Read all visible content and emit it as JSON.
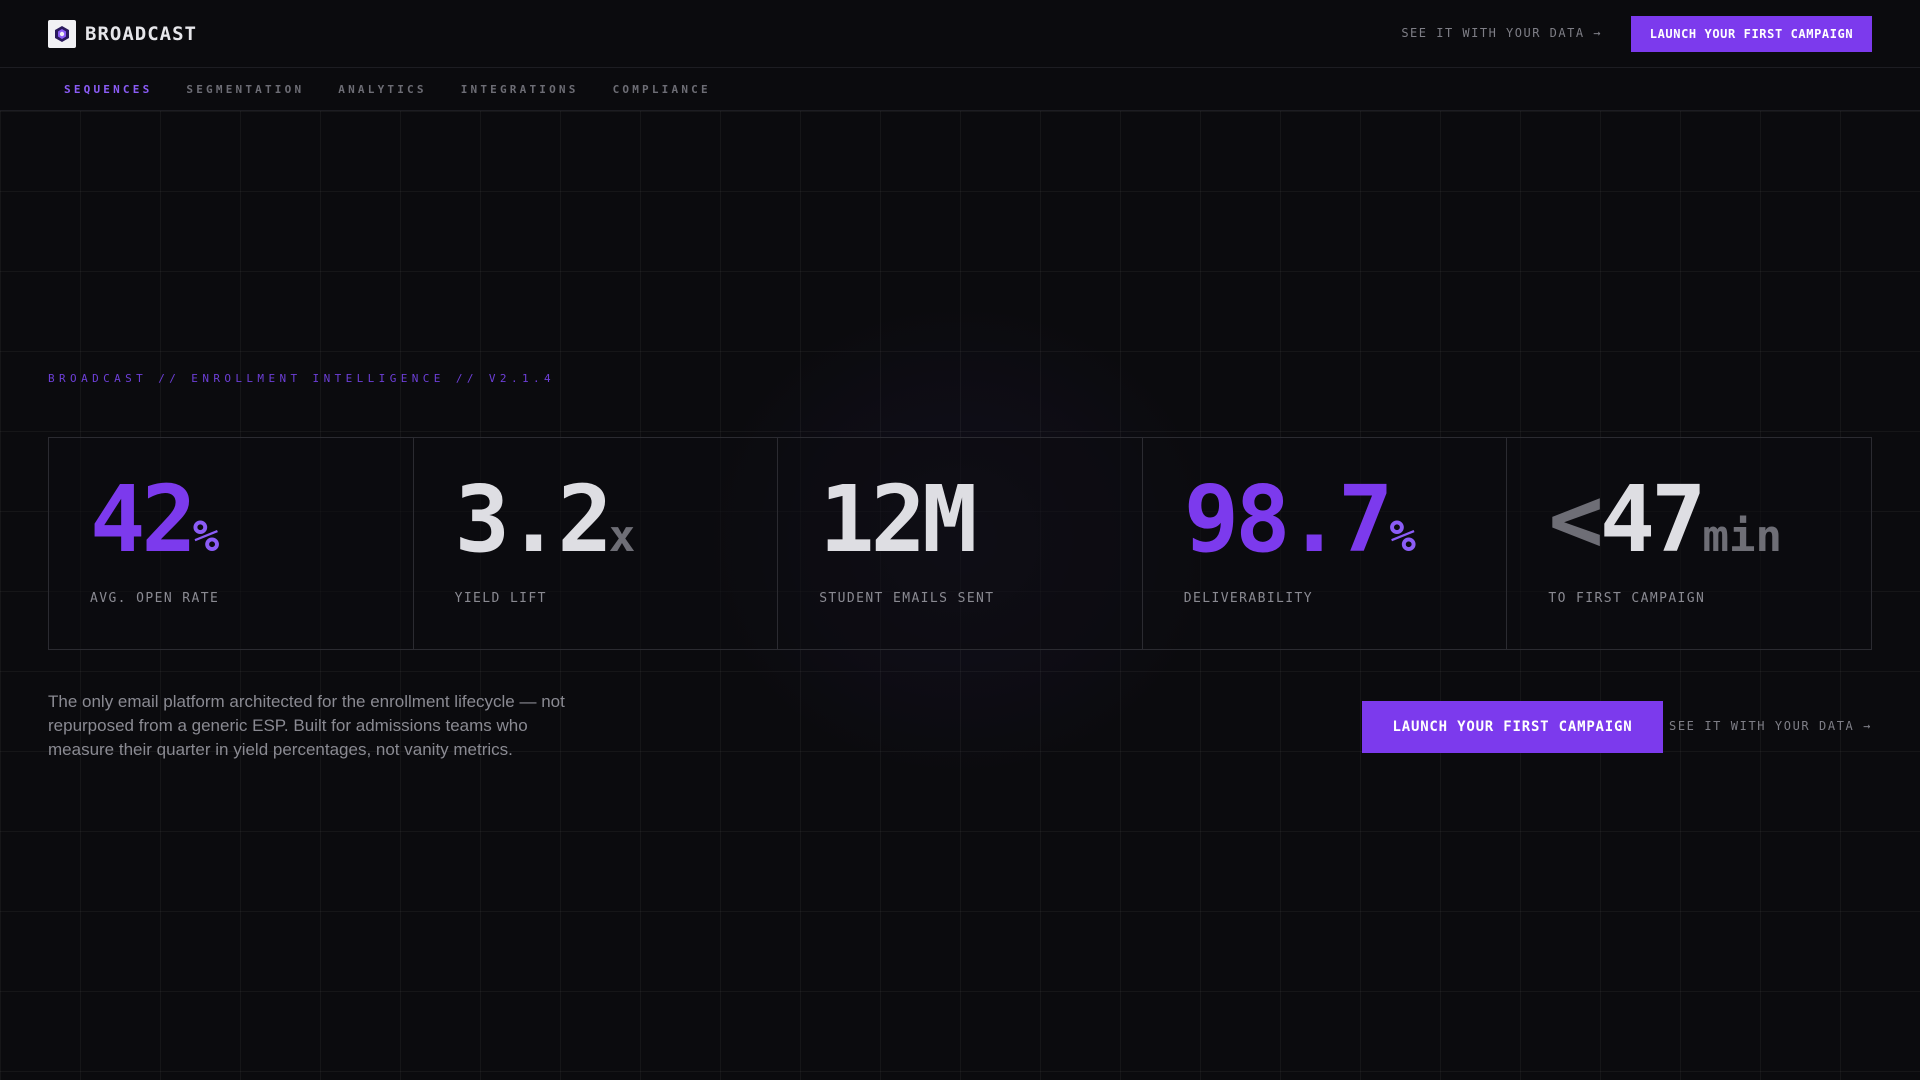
{
  "header": {
    "brand_name": "BROADCAST",
    "see_data_link": "SEE IT WITH YOUR DATA →",
    "cta_label": "LAUNCH YOUR FIRST CAMPAIGN"
  },
  "nav": {
    "items": [
      {
        "label": "SEQUENCES",
        "active": true
      },
      {
        "label": "SEGMENTATION"
      },
      {
        "label": "ANALYTICS"
      },
      {
        "label": "INTEGRATIONS"
      },
      {
        "label": "COMPLIANCE"
      }
    ]
  },
  "hero": {
    "eyebrow": "BROADCAST // ENROLLMENT INTELLIGENCE // V2.1.4",
    "stats": [
      {
        "prefix": "",
        "value": "42",
        "unit": "%",
        "label": "AVG. OPEN RATE"
      },
      {
        "prefix": "",
        "value": "3.2",
        "unit": "x",
        "label": "YIELD LIFT"
      },
      {
        "prefix": "",
        "value": "12M",
        "unit": "",
        "label": "STUDENT EMAILS SENT"
      },
      {
        "prefix": "",
        "value": "98.7",
        "unit": "%",
        "label": "DELIVERABILITY"
      },
      {
        "prefix": "<",
        "value": "47",
        "unit": "min",
        "label": "TO FIRST CAMPAIGN"
      }
    ],
    "description": "The only email platform architected for the enrollment lifecycle — not repurposed from a generic ESP. Built for admissions teams who measure their quarter in yield percentages, not vanity metrics.",
    "cta_label": "LAUNCH YOUR FIRST CAMPAIGN",
    "see_data_link": "SEE IT WITH YOUR DATA →"
  },
  "colors": {
    "accent": "#7c3aed",
    "background": "#0b0b0e"
  }
}
